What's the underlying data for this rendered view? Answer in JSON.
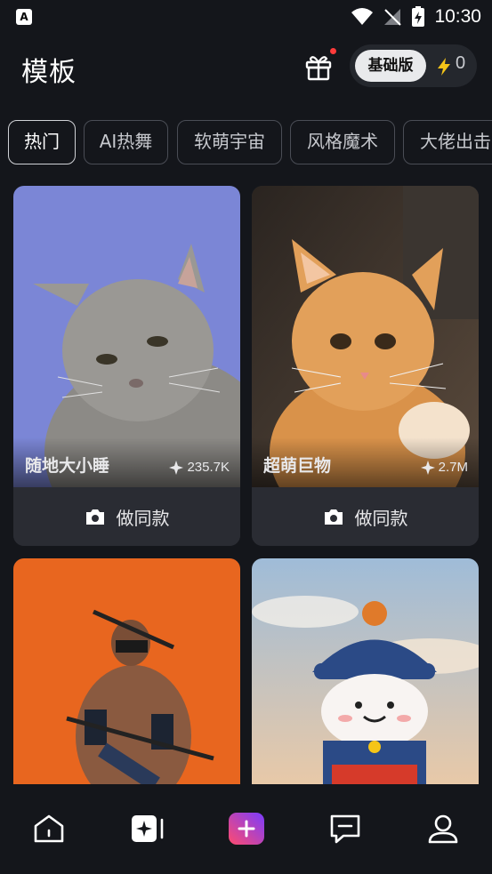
{
  "status_bar": {
    "time": "10:30",
    "app_icon_label": "A"
  },
  "header": {
    "title": "模板",
    "gift_icon": "gift-icon",
    "plan_label": "基础版",
    "credits": "0"
  },
  "tabs": [
    {
      "label": "热门",
      "active": true
    },
    {
      "label": "AI热舞",
      "active": false
    },
    {
      "label": "软萌宇宙",
      "active": false
    },
    {
      "label": "风格魔术",
      "active": false
    },
    {
      "label": "大佬出击",
      "active": false
    }
  ],
  "cards": [
    {
      "name": "随地大小睡",
      "count": "235.7K",
      "action": "做同款"
    },
    {
      "name": "超萌巨物",
      "count": "2.7M",
      "action": "做同款"
    },
    {
      "name": "",
      "count": "",
      "action": ""
    },
    {
      "name": "",
      "count": "",
      "action": ""
    }
  ],
  "nav": [
    {
      "icon": "home-icon"
    },
    {
      "icon": "sparkle-video-icon"
    },
    {
      "icon": "create-plus-icon"
    },
    {
      "icon": "message-icon"
    },
    {
      "icon": "profile-icon"
    }
  ],
  "colors": {
    "background": "#14161b",
    "card": "#2a2c33",
    "gradient_start": "#ff4b6e",
    "gradient_end": "#7a3cff",
    "bolt": "#f5c518"
  }
}
